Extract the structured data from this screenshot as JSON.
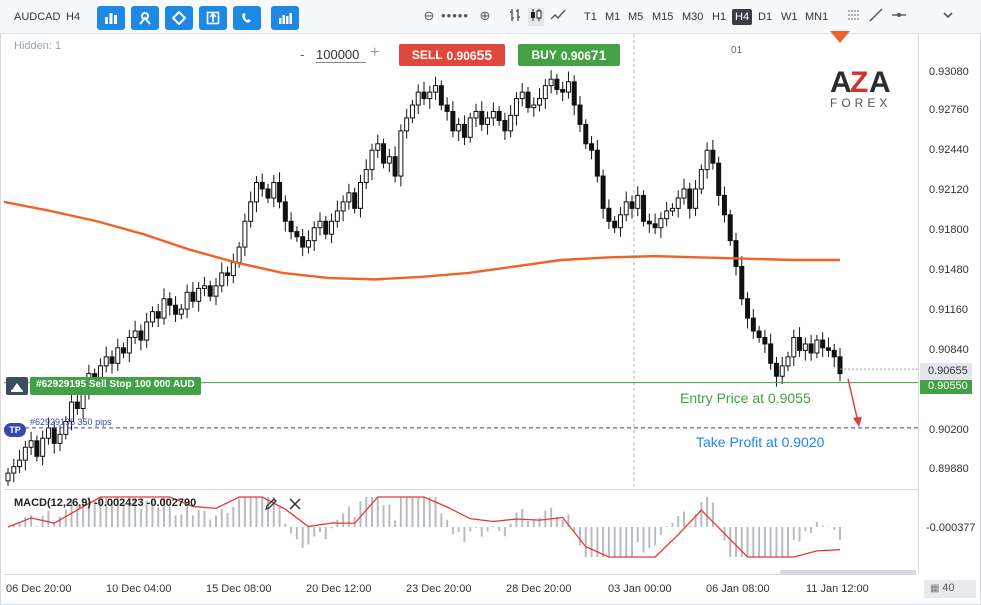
{
  "toolbar": {
    "symbol": "AUDCAD",
    "timeframe_label": "H4",
    "timeframes": [
      "T1",
      "M1",
      "M5",
      "M15",
      "M30",
      "H1",
      "H4",
      "D1",
      "W1",
      "MN1"
    ],
    "active_timeframe": "H4"
  },
  "chart": {
    "hidden_label": "Hidden: 1",
    "volume_value": "100000",
    "volume_minus": "-",
    "volume_plus": "+",
    "sell_label": "SELL",
    "sell_price_small": "0.906",
    "sell_price_big": "55",
    "buy_label": "BUY",
    "buy_price_small": "0.906",
    "buy_price_big": "71",
    "tab_label": "01",
    "logo_text": "AZA",
    "logo_sub": "FOREX",
    "order_label": "#62929195 Sell Stop 100 000 AUD",
    "tp_tag": "TP",
    "tp_text": "#62929195  350 pips",
    "entry_text": "Entry Price at 0.9055",
    "tp_price_text": "Take Profit at 0.9020",
    "current_price": "0.90655",
    "entry_price": "0.90550",
    "macd_label": "MACD(12,26,9) -0.002423 -0.002790",
    "macd_axis_value": "-0.000377",
    "zoom_value": "40",
    "colors": {
      "sell": "#e0483e",
      "buy": "#45a244",
      "ma": "#f0622a",
      "tp": "#3949ab",
      "entry": "#43a047",
      "macd_signal": "#e53935"
    }
  },
  "price_axis": [
    "0.93080",
    "0.92760",
    "0.92440",
    "0.92120",
    "0.91800",
    "0.91480",
    "0.91160",
    "0.90840",
    "0.90200",
    "0.89880"
  ],
  "time_axis": [
    "06 Dec 20:00",
    "10 Dec 04:00",
    "15 Dec 08:00",
    "20 Dec 12:00",
    "23 Dec 20:00",
    "28 Dec 20:00",
    "03 Jan 00:00",
    "06 Jan 08:00",
    "11 Jan 12:00"
  ],
  "chart_data": {
    "type": "candlestick",
    "symbol": "AUDCAD",
    "timeframe": "H4",
    "ylim": [
      0.8975,
      0.9325
    ],
    "closes": [
      0.8985,
      0.899,
      0.8995,
      0.9005,
      0.901,
      0.8998,
      0.9012,
      0.902,
      0.9008,
      0.9015,
      0.9025,
      0.904,
      0.9035,
      0.9048,
      0.9062,
      0.9055,
      0.9068,
      0.9075,
      0.907,
      0.9082,
      0.9078,
      0.909,
      0.9095,
      0.9088,
      0.9102,
      0.911,
      0.9105,
      0.912,
      0.9115,
      0.9108,
      0.9112,
      0.9125,
      0.9118,
      0.9128,
      0.913,
      0.9122,
      0.913,
      0.914,
      0.9138,
      0.9148,
      0.916,
      0.918,
      0.9195,
      0.921,
      0.9205,
      0.9198,
      0.921,
      0.9195,
      0.918,
      0.9172,
      0.9168,
      0.916,
      0.9165,
      0.9175,
      0.918,
      0.917,
      0.918,
      0.9188,
      0.9195,
      0.9202,
      0.919,
      0.921,
      0.922,
      0.9235,
      0.924,
      0.9225,
      0.923,
      0.9215,
      0.925,
      0.926,
      0.927,
      0.928,
      0.9275,
      0.928,
      0.9285,
      0.927,
      0.9265,
      0.925,
      0.9255,
      0.9245,
      0.926,
      0.9265,
      0.9255,
      0.926,
      0.9265,
      0.9258,
      0.925,
      0.9262,
      0.9275,
      0.928,
      0.9268,
      0.927,
      0.9275,
      0.9285,
      0.929,
      0.9282,
      0.928,
      0.9288,
      0.927,
      0.9255,
      0.924,
      0.9235,
      0.9215,
      0.919,
      0.918,
      0.9175,
      0.9185,
      0.9195,
      0.919,
      0.92,
      0.918,
      0.9178,
      0.9175,
      0.9182,
      0.9188,
      0.919,
      0.9198,
      0.9205,
      0.919,
      0.9205,
      0.922,
      0.9235,
      0.9225,
      0.92,
      0.9185,
      0.9165,
      0.9145,
      0.912,
      0.9105,
      0.9095,
      0.909,
      0.9085,
      0.907,
      0.906,
      0.9068,
      0.9075,
      0.909,
      0.908,
      0.9085,
      0.9078,
      0.9088,
      0.9082,
      0.908,
      0.9075,
      0.9062
    ],
    "moving_average": [
      0.9195,
      0.9188,
      0.918,
      0.917,
      0.9158,
      0.9148,
      0.914,
      0.9136,
      0.9135,
      0.9137,
      0.914,
      0.9145,
      0.915,
      0.9152,
      0.9153,
      0.9152,
      0.9151,
      0.915,
      0.915
    ],
    "entry_price": 0.9055,
    "take_profit": 0.902,
    "current_price": 0.90655
  }
}
